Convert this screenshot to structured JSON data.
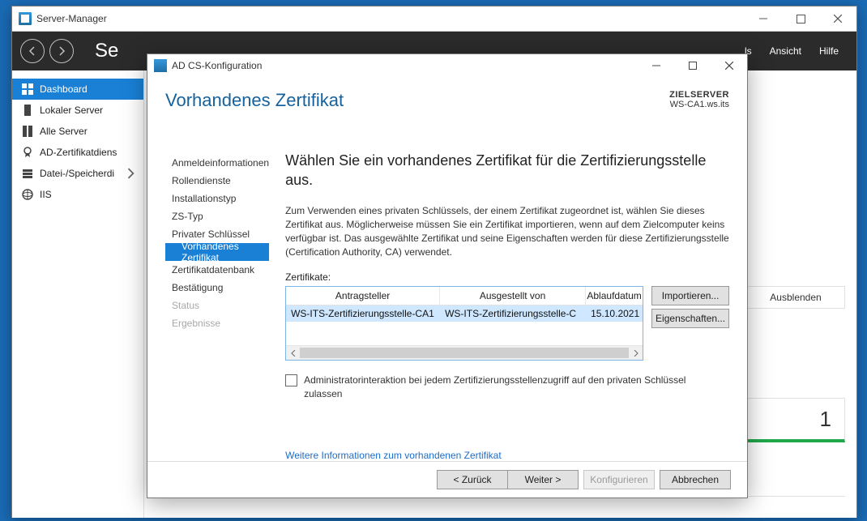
{
  "serverManager": {
    "title": "Server-Manager",
    "headingTruncated": "Se",
    "menu": {
      "details": "ls",
      "view": "Ansicht",
      "help": "Hilfe"
    },
    "sidebar": [
      {
        "label": "Dashboard",
        "icon": "dashboard",
        "active": true
      },
      {
        "label": "Lokaler Server",
        "icon": "server"
      },
      {
        "label": "Alle Server",
        "icon": "servers"
      },
      {
        "label": "AD-Zertifikatdiens",
        "icon": "cert"
      },
      {
        "label": "Datei-/Speicherdi",
        "icon": "storage"
      },
      {
        "label": "IIS",
        "icon": "iis"
      }
    ],
    "tileHideLabel": "Ausblenden",
    "tileCount": "1"
  },
  "dialog": {
    "title": "AD CS-Konfiguration",
    "headerTitle": "Vorhandenes Zertifikat",
    "targetLabel": "ZIELSERVER",
    "targetValue": "WS-CA1.ws.its",
    "steps": [
      {
        "label": "Anmeldeinformationen"
      },
      {
        "label": "Rollendienste"
      },
      {
        "label": "Installationstyp"
      },
      {
        "label": "ZS-Typ"
      },
      {
        "label": "Privater Schlüssel"
      },
      {
        "label": "Vorhandenes Zertifikat",
        "active": true,
        "sub": true
      },
      {
        "label": "Zertifikatdatenbank"
      },
      {
        "label": "Bestätigung"
      },
      {
        "label": "Status",
        "disabled": true
      },
      {
        "label": "Ergebnisse",
        "disabled": true
      }
    ],
    "pane": {
      "heading": "Wählen Sie ein vorhandenes Zertifikat für die Zertifizierungsstelle aus.",
      "desc": "Zum Verwenden eines privaten Schlüssels, der einem Zertifikat zugeordnet ist, wählen Sie dieses Zertifikat aus. Möglicherweise müssen Sie ein Zertifikat importieren, wenn auf dem Zielcomputer keins verfügbar ist. Das ausgewählte Zertifikat und seine Eigenschaften werden für diese Zertifizierungsstelle (Certification Authority, CA) verwendet.",
      "listLabel": "Zertifikate:",
      "columns": {
        "subject": "Antragsteller",
        "issuer": "Ausgestellt von",
        "expiry": "Ablaufdatum"
      },
      "rows": [
        {
          "subject": "WS-ITS-Zertifizierungsstelle-CA1",
          "issuer": "WS-ITS-Zertifizierungsstelle-C",
          "expiry": "15.10.2021"
        }
      ],
      "btnImport": "Importieren...",
      "btnProps": "Eigenschaften...",
      "checkboxLabel": "Administratorinteraktion bei jedem Zertifizierungsstellenzugriff auf den privaten Schlüssel zulassen",
      "linkText": "Weitere Informationen zum vorhandenen Zertifikat"
    },
    "footer": {
      "back": "< Zurück",
      "next": "Weiter >",
      "configure": "Konfigurieren",
      "cancel": "Abbrechen"
    }
  }
}
